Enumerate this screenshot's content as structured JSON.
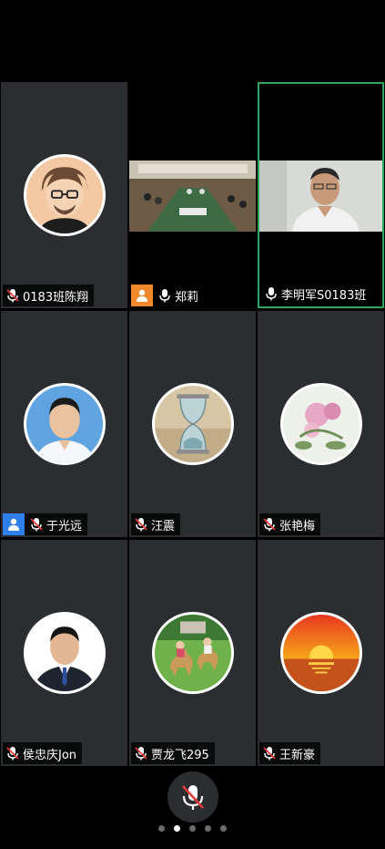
{
  "participants": [
    {
      "name": "0183班陈翔",
      "muted": true,
      "type": "avatar",
      "avatar": "cartoon-man-avatar"
    },
    {
      "name": "郑莉",
      "muted": false,
      "type": "video",
      "badge": "orange-person-icon"
    },
    {
      "name": "李明军S0183班",
      "muted": false,
      "type": "video",
      "active": true
    },
    {
      "name": "于光远",
      "muted": true,
      "type": "avatar",
      "avatar": "man-blue-shirt-avatar",
      "badge": "blue-person-icon"
    },
    {
      "name": "汪震",
      "muted": true,
      "type": "avatar",
      "avatar": "hourglass-avatar"
    },
    {
      "name": "张艳梅",
      "muted": true,
      "type": "avatar",
      "avatar": "flower-painting-avatar"
    },
    {
      "name": "侯忠庆Jon",
      "muted": true,
      "type": "avatar",
      "avatar": "man-suit-avatar"
    },
    {
      "name": "贾龙飞295",
      "muted": true,
      "type": "avatar",
      "avatar": "children-on-toy-deer-avatar"
    },
    {
      "name": "王新豪",
      "muted": true,
      "type": "avatar",
      "avatar": "sunset-avatar"
    }
  ],
  "controls": {
    "mic_muted": true
  },
  "pagination": {
    "total": 5,
    "current": 2
  },
  "colors": {
    "tile_bg": "#2c2d30",
    "active_border": "#2fa45a",
    "muted_red": "#e03b3b",
    "badge_orange": "#f0892b",
    "badge_blue": "#2f80ed"
  }
}
